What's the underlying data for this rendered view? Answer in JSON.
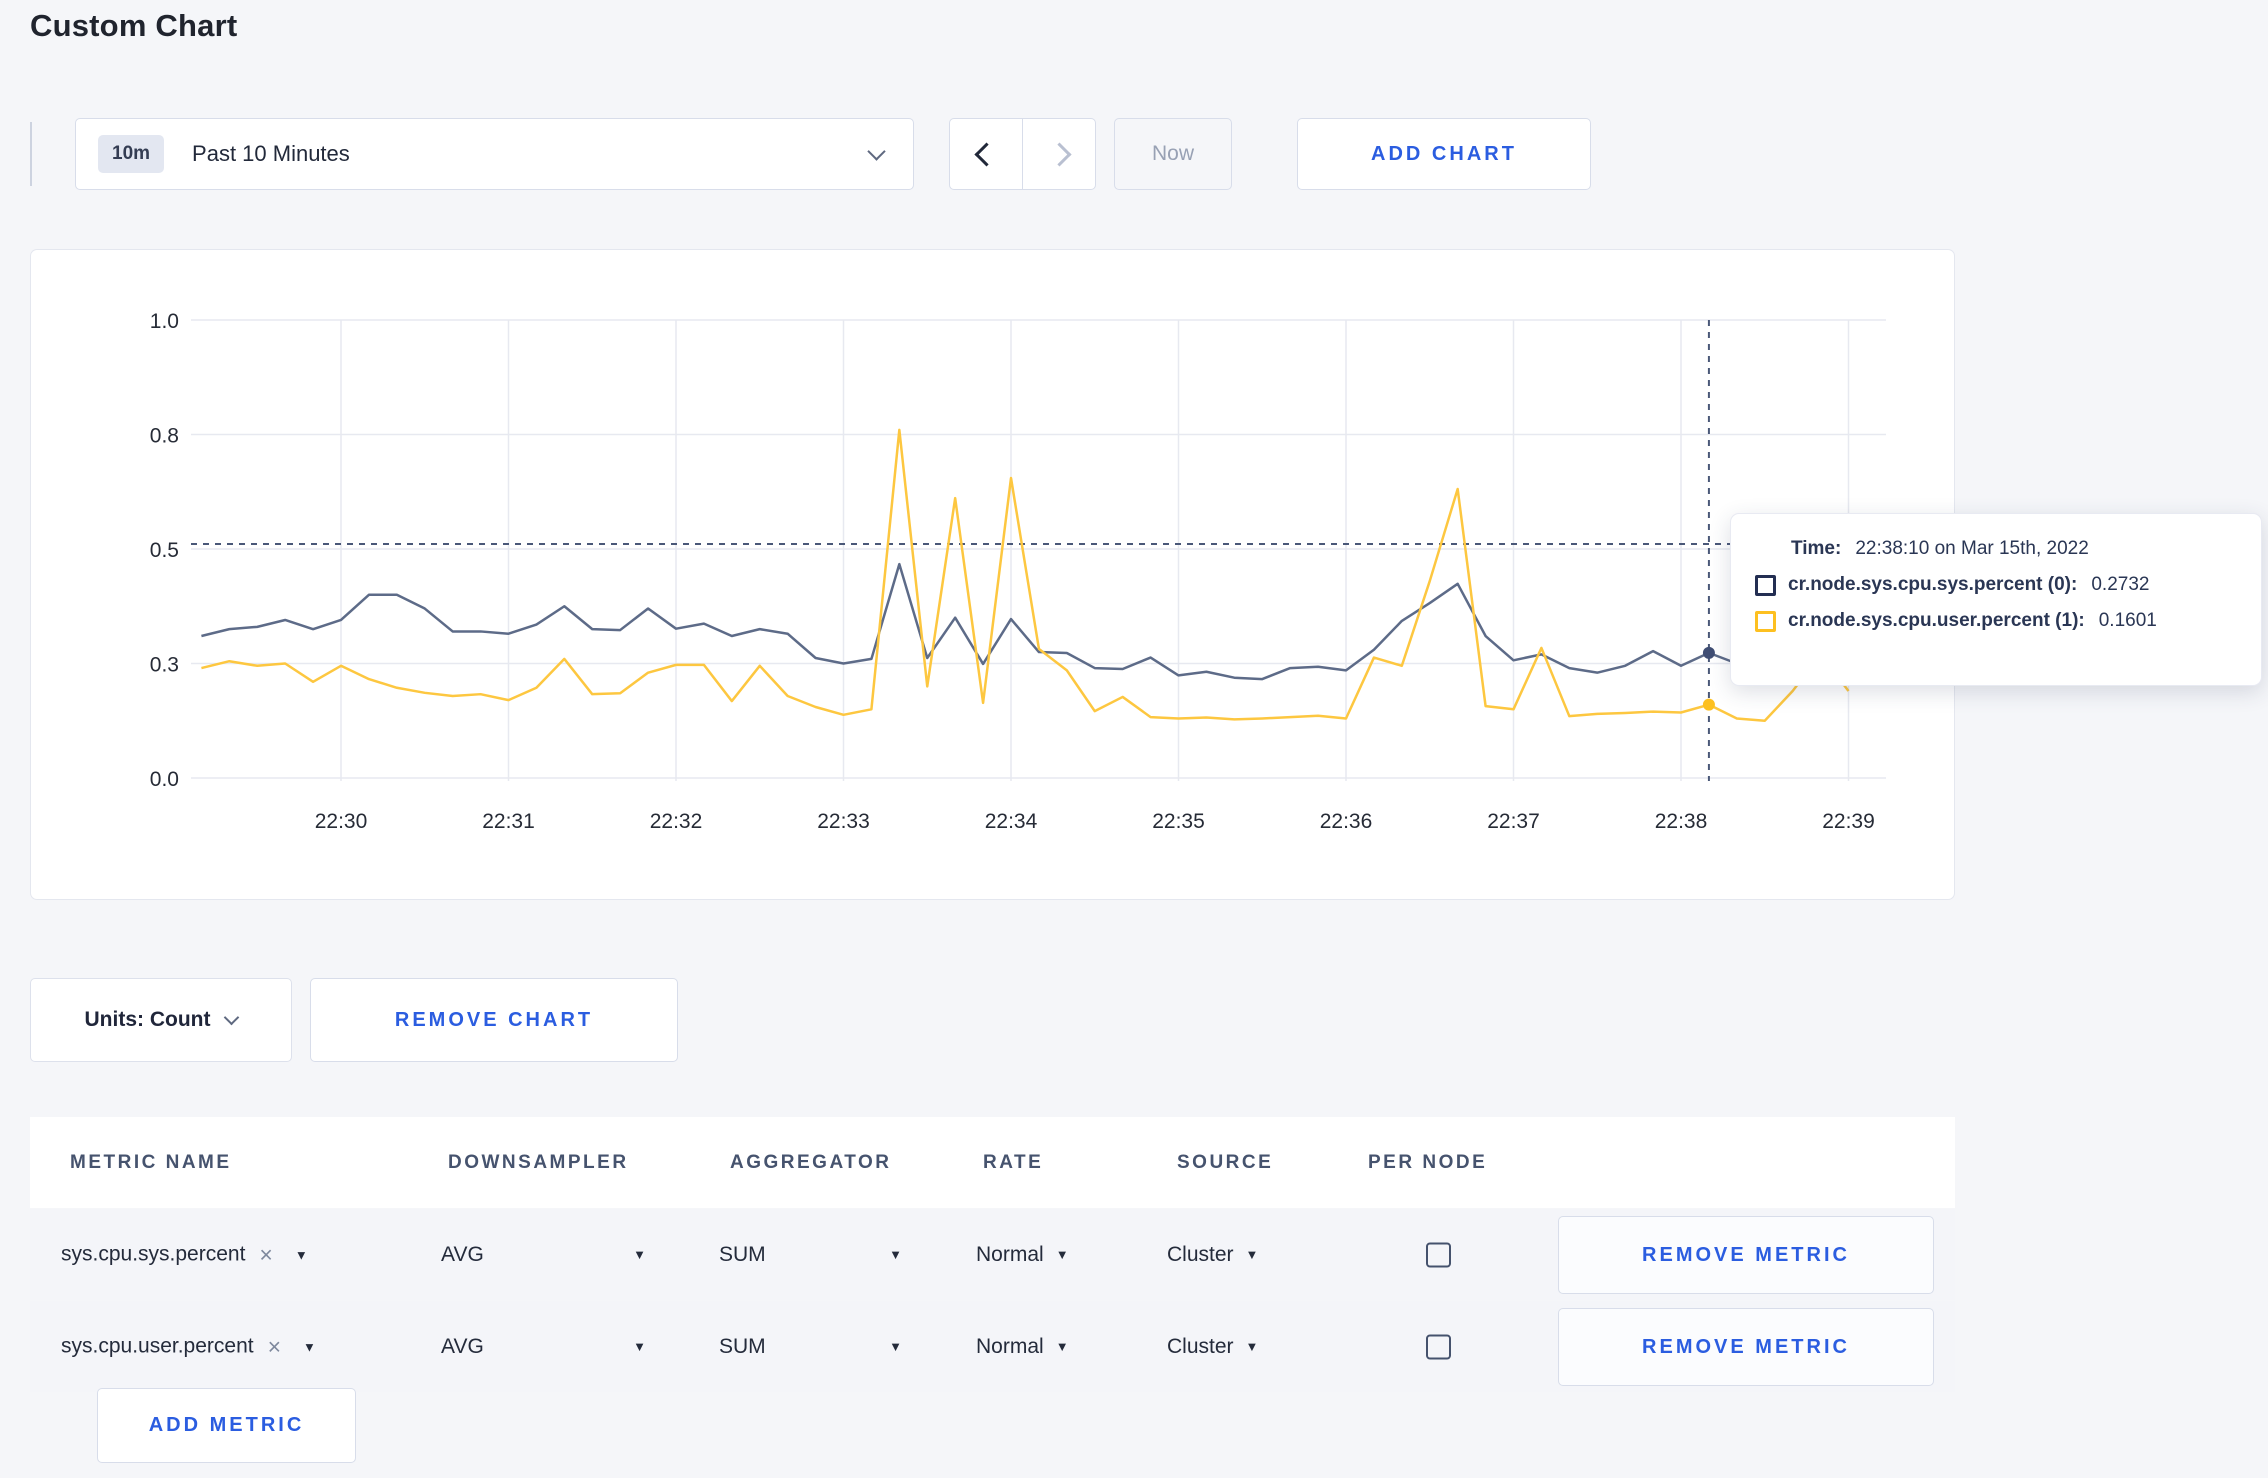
{
  "page": {
    "title": "Custom Chart"
  },
  "toolbar": {
    "range_badge": "10m",
    "range_label": "Past 10 Minutes",
    "now_label": "Now",
    "add_chart_label": "ADD CHART"
  },
  "chart_data": {
    "type": "line",
    "title": "",
    "xlabel": "",
    "ylabel": "",
    "ylim": [
      0,
      1
    ],
    "grid": true,
    "legend_position": "tooltip",
    "y_tick_values": [
      0,
      0.25,
      0.5,
      0.75,
      1
    ],
    "y_tick_labels": [
      "0.0",
      "0.3",
      "0.5",
      "0.8",
      "1.0"
    ],
    "x_tick_labels": [
      "22:30",
      "22:31",
      "22:32",
      "22:33",
      "22:34",
      "22:35",
      "22:36",
      "22:37",
      "22:38",
      "22:39"
    ],
    "x_start_time": "22:29:10",
    "x_interval_seconds": 10,
    "x_start_offset_seconds": -50,
    "series": [
      {
        "name": "cr.node.sys.cpu.sys.percent (0)",
        "color": "#5d6b88",
        "dot_color": "#3f4d73",
        "values": [
          0.31,
          0.325,
          0.33,
          0.345,
          0.325,
          0.345,
          0.4,
          0.4,
          0.37,
          0.32,
          0.32,
          0.315,
          0.335,
          0.375,
          0.325,
          0.323,
          0.37,
          0.326,
          0.337,
          0.31,
          0.325,
          0.315,
          0.262,
          0.25,
          0.26,
          0.467,
          0.262,
          0.35,
          0.249,
          0.347,
          0.275,
          0.273,
          0.24,
          0.238,
          0.263,
          0.224,
          0.232,
          0.219,
          0.216,
          0.24,
          0.243,
          0.235,
          0.28,
          0.343,
          0.382,
          0.424,
          0.31,
          0.257,
          0.27,
          0.24,
          0.23,
          0.245,
          0.277,
          0.245,
          0.2732,
          0.25,
          0.26,
          0.25,
          0.26,
          0.255
        ]
      },
      {
        "name": "cr.node.sys.cpu.user.percent (1)",
        "color": "#fdc740",
        "dot_color": "#fdc020",
        "values": [
          0.24,
          0.255,
          0.245,
          0.25,
          0.21,
          0.245,
          0.216,
          0.197,
          0.186,
          0.179,
          0.183,
          0.17,
          0.197,
          0.26,
          0.183,
          0.185,
          0.23,
          0.247,
          0.247,
          0.168,
          0.245,
          0.179,
          0.155,
          0.138,
          0.15,
          0.76,
          0.2,
          0.611,
          0.164,
          0.655,
          0.282,
          0.235,
          0.146,
          0.177,
          0.133,
          0.13,
          0.132,
          0.128,
          0.13,
          0.133,
          0.136,
          0.13,
          0.263,
          0.245,
          0.43,
          0.631,
          0.157,
          0.15,
          0.284,
          0.135,
          0.14,
          0.142,
          0.145,
          0.143,
          0.1601,
          0.13,
          0.125,
          0.19,
          0.27,
          0.19
        ]
      }
    ],
    "crosshair": {
      "time": "22:38:10",
      "x_index": 54,
      "y_value": 0.511,
      "color": "#4a5878"
    }
  },
  "tooltip": {
    "time_label": "Time:",
    "time_value": "22:38:10 on Mar 15th, 2022",
    "series": [
      {
        "label": "cr.node.sys.cpu.sys.percent (0):",
        "value": "0.2732",
        "color": "#232e52"
      },
      {
        "label": "cr.node.sys.cpu.user.percent (1):",
        "value": "0.1601",
        "color": "#fdc020"
      }
    ]
  },
  "chart_controls": {
    "units_label": "Units: Count",
    "remove_chart_label": "REMOVE CHART",
    "add_metric_label": "ADD METRIC"
  },
  "metrics_table": {
    "headers": [
      "METRIC NAME",
      "DOWNSAMPLER",
      "AGGREGATOR",
      "RATE",
      "SOURCE",
      "PER NODE"
    ],
    "rows": [
      {
        "metric_name": "sys.cpu.sys.percent",
        "downsampler": "AVG",
        "aggregator": "SUM",
        "rate": "Normal",
        "source": "Cluster",
        "per_node_checked": false,
        "remove_label": "REMOVE METRIC"
      },
      {
        "metric_name": "sys.cpu.user.percent",
        "downsampler": "AVG",
        "aggregator": "SUM",
        "rate": "Normal",
        "source": "Cluster",
        "per_node_checked": false,
        "remove_label": "REMOVE METRIC"
      }
    ]
  }
}
